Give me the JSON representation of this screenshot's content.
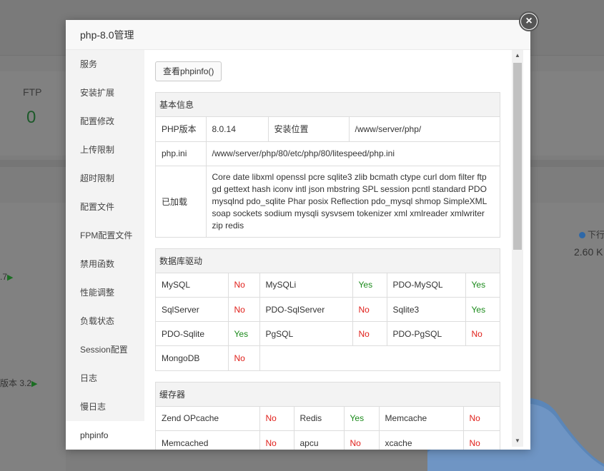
{
  "background": {
    "ftp_label": "FTP",
    "ftp_value": "0",
    "left_note1": ".7",
    "left_note2": "版本 3.2",
    "right_legend": "下行",
    "right_value": "2.60 K"
  },
  "modal": {
    "title": "php-8.0管理",
    "sidebar": [
      {
        "label": "服务"
      },
      {
        "label": "安装扩展"
      },
      {
        "label": "配置修改"
      },
      {
        "label": "上传限制"
      },
      {
        "label": "超时限制"
      },
      {
        "label": "配置文件"
      },
      {
        "label": "FPM配置文件"
      },
      {
        "label": "禁用函数"
      },
      {
        "label": "性能调整"
      },
      {
        "label": "负载状态"
      },
      {
        "label": "Session配置"
      },
      {
        "label": "日志"
      },
      {
        "label": "慢日志"
      },
      {
        "label": "phpinfo"
      }
    ],
    "active_item": "phpinfo",
    "phpinfo_button": "查看phpinfo()",
    "basic": {
      "title": "基本信息",
      "php_version_label": "PHP版本",
      "php_version": "8.0.14",
      "install_label": "安装位置",
      "install_path": "/www/server/php/",
      "ini_label": "php.ini",
      "ini_path": "/www/server/php/80/etc/php/80/litespeed/php.ini",
      "loaded_label": "已加载",
      "loaded_modules": "Core date libxml openssl pcre sqlite3 zlib bcmath ctype curl dom filter ftp gd gettext hash iconv intl json mbstring SPL session pcntl standard PDO mysqlnd pdo_sqlite Phar posix Reflection pdo_mysql shmop SimpleXML soap sockets sodium mysqli sysvsem tokenizer xml xmlreader xmlwriter zip redis"
    },
    "db": {
      "title": "数据库驱动",
      "rows": [
        [
          {
            "name": "MySQL",
            "status": "No"
          },
          {
            "name": "MySQLi",
            "status": "Yes"
          },
          {
            "name": "PDO-MySQL",
            "status": "Yes"
          }
        ],
        [
          {
            "name": "SqlServer",
            "status": "No"
          },
          {
            "name": "PDO-SqlServer",
            "status": "No"
          },
          {
            "name": "Sqlite3",
            "status": "Yes"
          }
        ],
        [
          {
            "name": "PDO-Sqlite",
            "status": "Yes"
          },
          {
            "name": "PgSQL",
            "status": "No"
          },
          {
            "name": "PDO-PgSQL",
            "status": "No"
          }
        ],
        [
          {
            "name": "MongoDB",
            "status": "No"
          }
        ]
      ]
    },
    "cache": {
      "title": "缓存器",
      "rows": [
        [
          {
            "name": "Zend OPcache",
            "status": "No"
          },
          {
            "name": "Redis",
            "status": "Yes"
          },
          {
            "name": "Memcache",
            "status": "No"
          }
        ],
        [
          {
            "name": "Memcached",
            "status": "No"
          },
          {
            "name": "apcu",
            "status": "No"
          },
          {
            "name": "xcache",
            "status": "No"
          }
        ]
      ]
    }
  },
  "colors": {
    "no": "#e0201b",
    "yes": "#1a8a1a",
    "sidebar_bg": "#f3f3f3",
    "header_bg": "#f8f8f8"
  },
  "icons": {
    "close": "close-icon",
    "scroll_up": "arrow-up-icon",
    "scroll_down": "arrow-down-icon"
  }
}
